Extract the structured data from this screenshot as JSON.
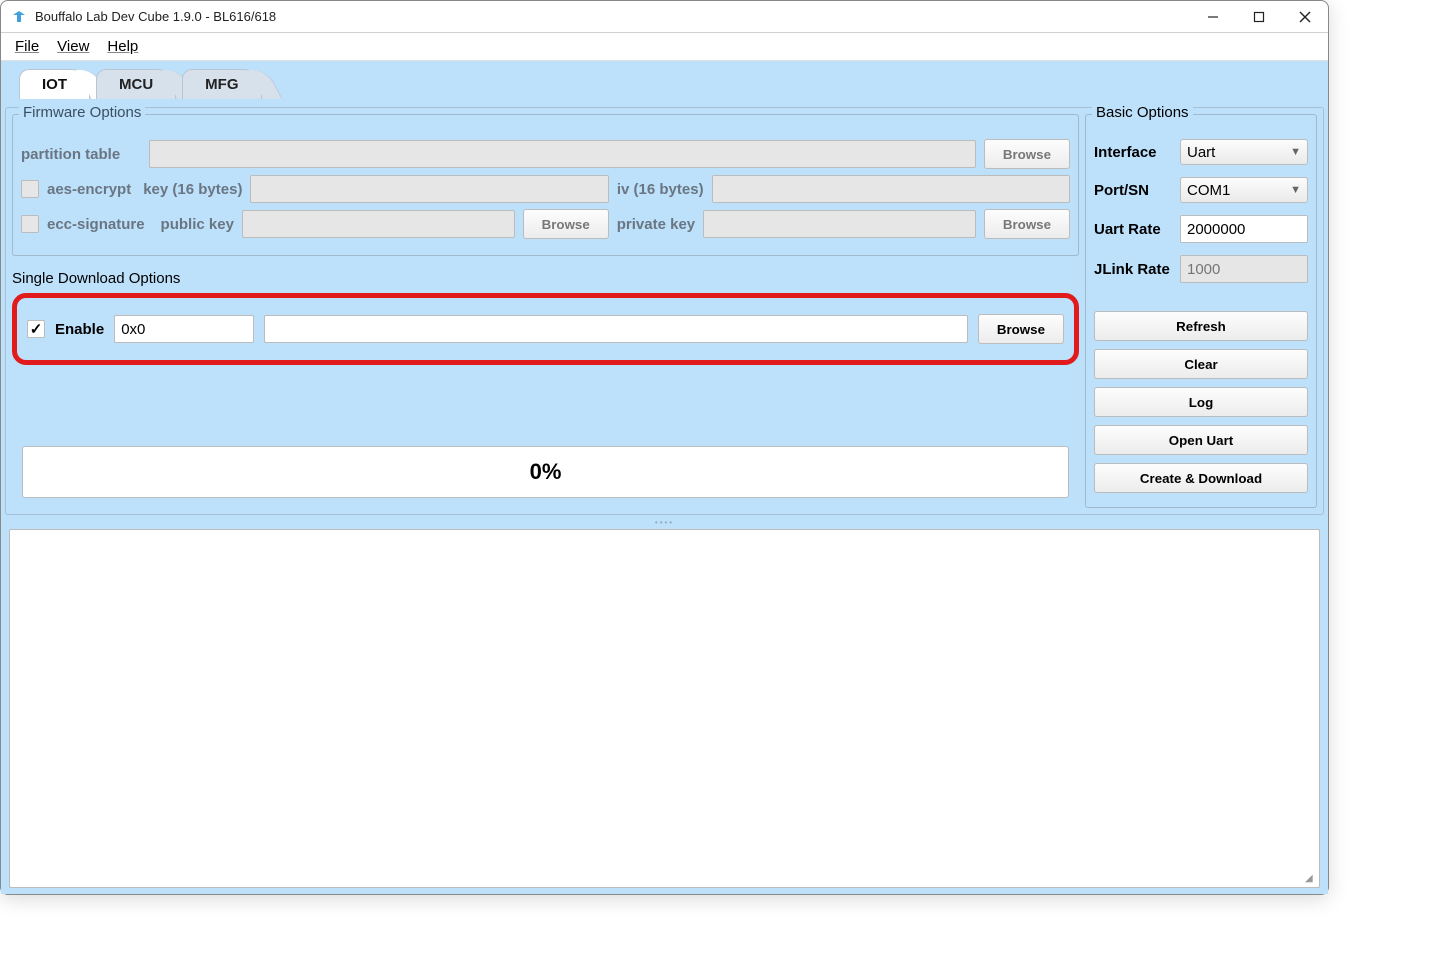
{
  "titlebar": {
    "title": "Bouffalo Lab Dev Cube 1.9.0 - BL616/618"
  },
  "menu": {
    "file": "File",
    "view": "View",
    "help": "Help"
  },
  "tabs": {
    "iot": "IOT",
    "mcu": "MCU",
    "mfg": "MFG"
  },
  "firmware": {
    "group_title": "Firmware Options",
    "partition_label": "partition table",
    "partition_value": "",
    "partition_browse": "Browse",
    "aes_label": "aes-encrypt",
    "key_label": "key (16 bytes)",
    "key_value": "",
    "iv_label": "iv (16 bytes)",
    "iv_value": "",
    "ecc_label": "ecc-signature",
    "pubkey_label": "public key",
    "pubkey_value": "",
    "pubkey_browse": "Browse",
    "privkey_label": "private key",
    "privkey_value": "",
    "privkey_browse": "Browse"
  },
  "single_download": {
    "title": "Single Download Options",
    "enable_label": "Enable",
    "addr_value": "0x0",
    "path_value": "",
    "browse": "Browse"
  },
  "basic": {
    "group_title": "Basic Options",
    "interface_label": "Interface",
    "interface_value": "Uart",
    "port_label": "Port/SN",
    "port_value": "COM1",
    "uartrate_label": "Uart Rate",
    "uartrate_value": "2000000",
    "jlinkrate_label": "JLink Rate",
    "jlinkrate_placeholder": "1000",
    "buttons": {
      "refresh": "Refresh",
      "clear": "Clear",
      "log": "Log",
      "open_uart": "Open Uart",
      "create_download": "Create & Download"
    }
  },
  "progress": {
    "text": "0%"
  }
}
